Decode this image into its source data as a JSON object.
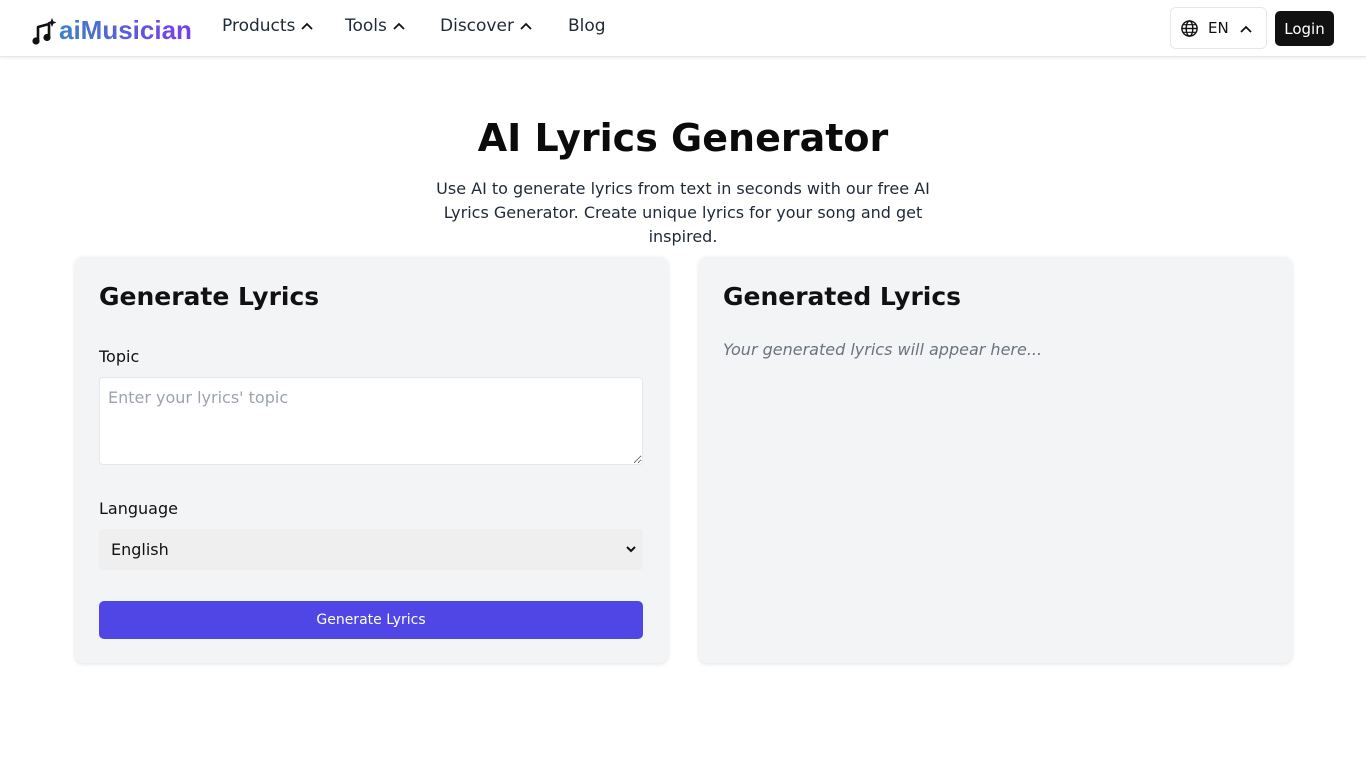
{
  "header": {
    "brand": "aiMusician",
    "nav": [
      {
        "label": "Products"
      },
      {
        "label": "Tools"
      },
      {
        "label": "Discover"
      },
      {
        "label": "Blog"
      }
    ],
    "language": "EN",
    "login_label": "Login"
  },
  "hero": {
    "title": "AI Lyrics Generator",
    "subtitle": "Use AI to generate lyrics from text in seconds with our free AI Lyrics Generator. Create unique lyrics for your song and get inspired."
  },
  "form": {
    "title": "Generate Lyrics",
    "topic_label": "Topic",
    "topic_placeholder": "Enter your lyrics' topic",
    "topic_value": "",
    "language_label": "Language",
    "language_value": "English",
    "submit_label": "Generate Lyrics"
  },
  "output": {
    "title": "Generated Lyrics",
    "placeholder": "Your generated lyrics will appear here..."
  },
  "colors": {
    "brand_gradient_start": "#3b82c6",
    "brand_gradient_end": "#7c3aed",
    "primary_button": "#4f46e5",
    "card_background": "#f3f4f6"
  }
}
